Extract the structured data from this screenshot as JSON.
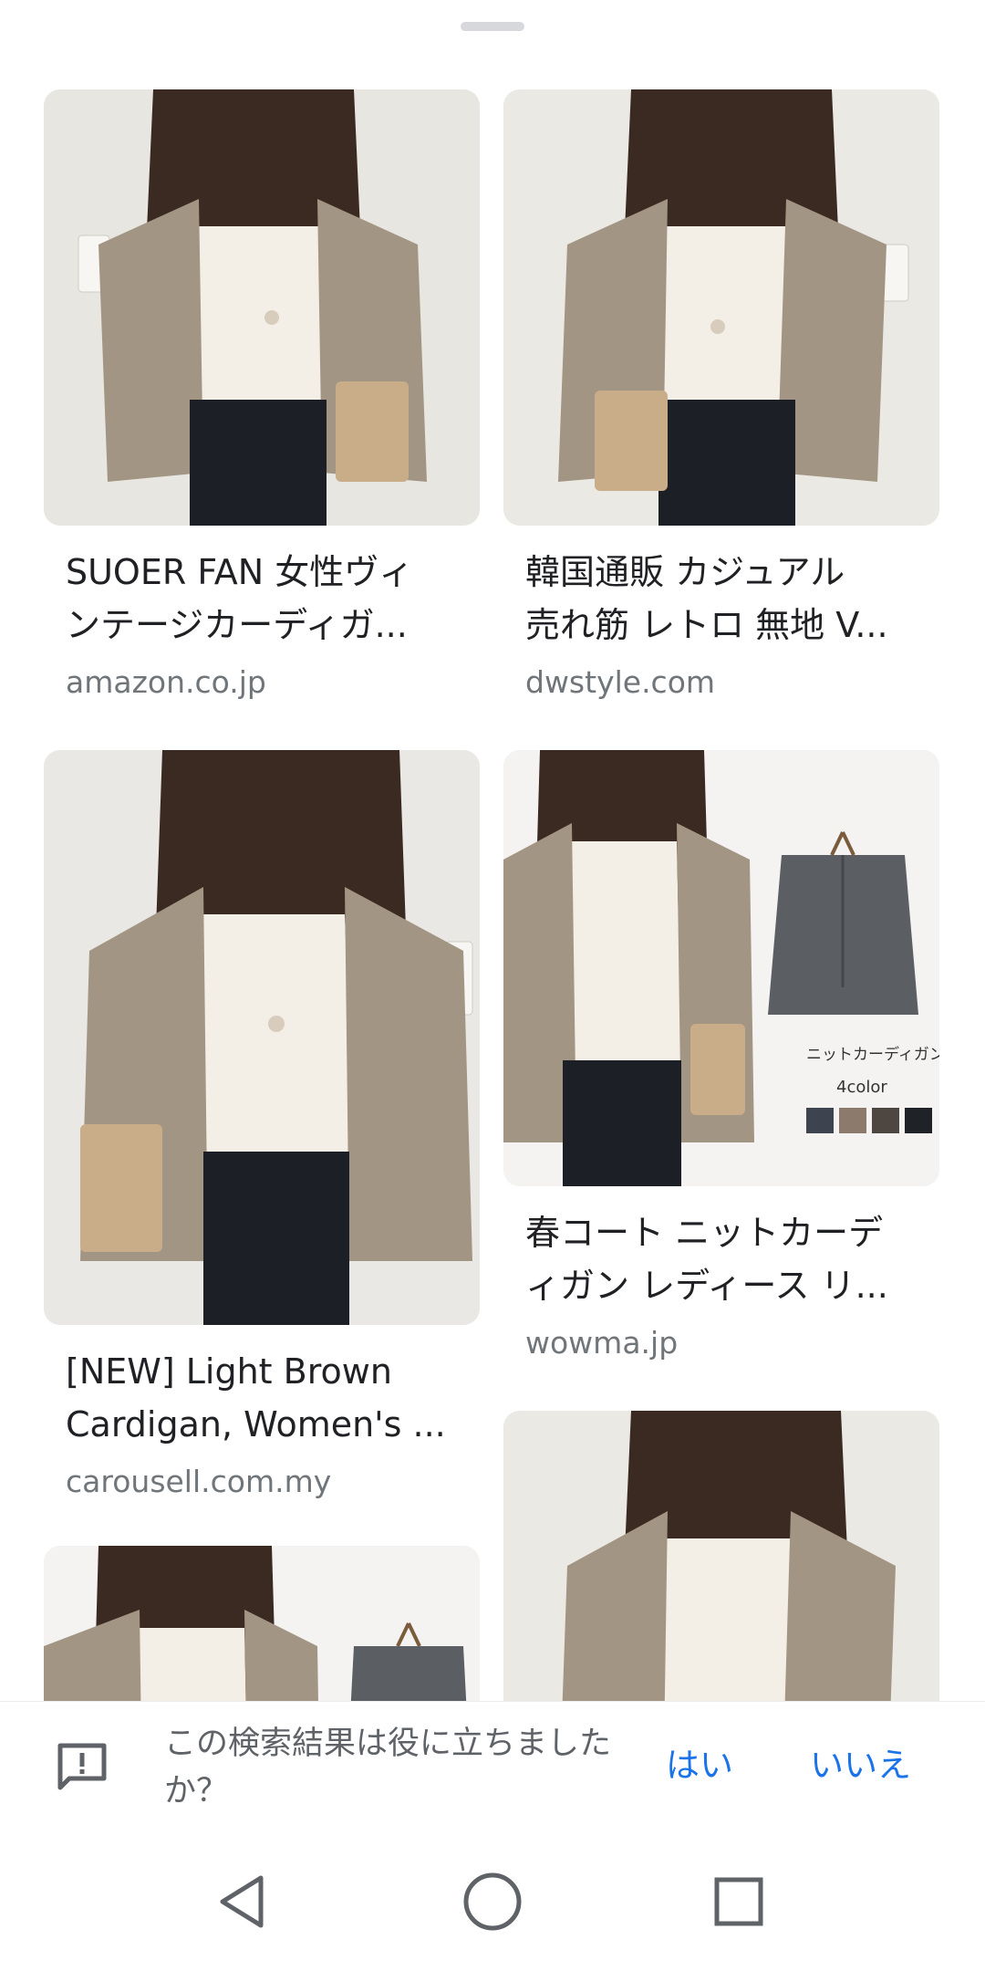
{
  "results": [
    {
      "title_line1": "SUOER FAN 女性ヴィ",
      "title_line2": "ンテージカーディガ...",
      "source": "amazon.co.jp"
    },
    {
      "title_line1": "韓国通販 カジュアル",
      "title_line2": "売れ筋 レトロ 無地 V...",
      "source": "dwstyle.com"
    },
    {
      "title_line1": "[NEW] Light Brown",
      "title_line2": "Cardigan, Women's ...",
      "source": "carousell.com.my"
    },
    {
      "title_line1": "春コート ニットカーデ",
      "title_line2": "ィガン レディース リ...",
      "source": "wowma.jp",
      "image_label": "ニットカーディガン",
      "image_sublabel": "4color",
      "swatches": [
        "#3d4450",
        "#8c7b6c",
        "#4e4640",
        "#1f2227"
      ]
    },
    {
      "title_line1": "",
      "title_line2": "",
      "source": ""
    },
    {
      "title_line1": "",
      "title_line2": "",
      "source": ""
    }
  ],
  "feedback": {
    "question": "この検索結果は役に立ちましたか？",
    "yes_label": "はい",
    "no_label": "いいえ",
    "icon": "feedback-icon"
  },
  "navbar": {
    "back_icon": "back-triangle-icon",
    "home_icon": "home-circle-icon",
    "recent_icon": "recent-square-icon"
  },
  "colors": {
    "accent": "#1a73e8",
    "title_text": "#202124",
    "secondary_text": "#70757a",
    "cardigan": "#a39583",
    "blouse": "#f3efe6",
    "hair": "#3b2a22"
  }
}
